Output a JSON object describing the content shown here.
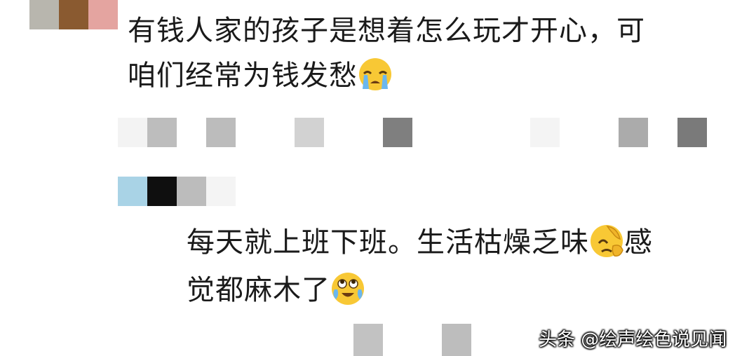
{
  "comment1": {
    "line1": "有钱人家的孩子是想着怎么玩才开心，可",
    "line2": "咱们经常为钱发愁",
    "emoji": "crying-face-icon"
  },
  "comment2": {
    "line1": "每天就上班下班。生活枯燥乏味",
    "line1_tail": "感",
    "line2": "觉都麻木了",
    "emojis": [
      "facepalm-icon",
      "tears-of-joy-looking-up-icon"
    ]
  },
  "watermark": {
    "text": "头条 @绘声绘色说见闻"
  },
  "colors": {
    "text": "#1a1a1a",
    "emoji_yellow": "#f8c835",
    "tear_blue": "#6bb7ee"
  }
}
